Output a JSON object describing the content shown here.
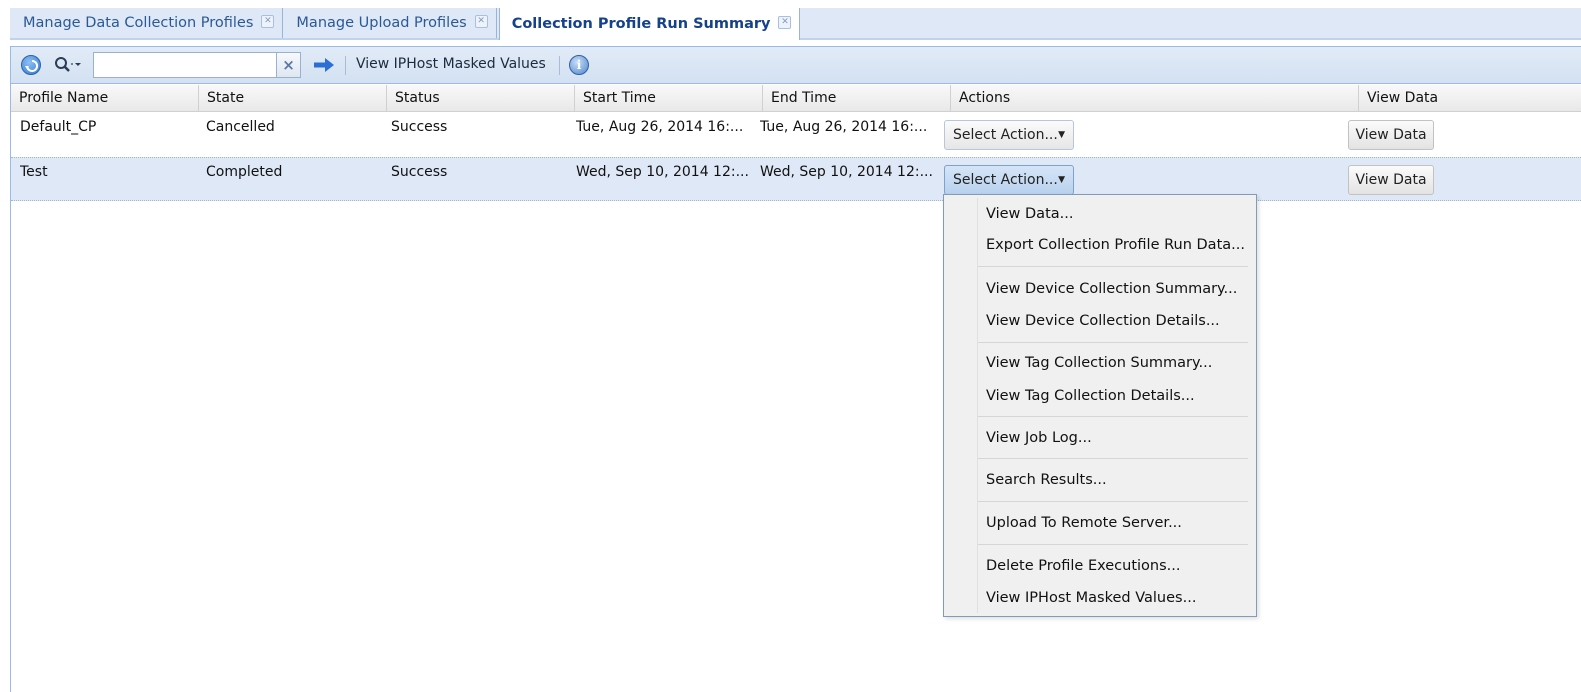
{
  "tabs": [
    {
      "label": "Manage Data Collection Profiles",
      "active": false
    },
    {
      "label": "Manage Upload Profiles",
      "active": false
    },
    {
      "label": "Collection Profile Run Summary",
      "active": true
    }
  ],
  "toolbar": {
    "search_value": "",
    "clear_label": "×",
    "masked_values_label": "View IPHost Masked Values",
    "info_label": "i"
  },
  "grid": {
    "columns": [
      "Profile Name",
      "State",
      "Status",
      "Start Time",
      "End Time",
      "Actions",
      "View Data"
    ],
    "rows": [
      {
        "profile_name": "Default_CP",
        "state": "Cancelled",
        "status": "Success",
        "start_time": "Tue, Aug 26, 2014 16:...",
        "end_time": "Tue, Aug 26, 2014 16:...",
        "action_label": "Select Action...",
        "view_data_label": "View Data"
      },
      {
        "profile_name": "Test",
        "state": "Completed",
        "status": "Success",
        "start_time": "Wed, Sep 10, 2014 12:...",
        "end_time": "Wed, Sep 10, 2014 12:...",
        "action_label": "Select Action...",
        "view_data_label": "View Data"
      }
    ]
  },
  "action_menu": {
    "items": [
      "View Data...",
      "Export Collection Profile Run Data...",
      "View Device Collection Summary...",
      "View Device Collection Details...",
      "View Tag Collection Summary...",
      "View Tag Collection Details...",
      "View Job Log...",
      "Search Results...",
      "Upload To Remote Server...",
      "Delete Profile Executions...",
      "View IPHost Masked Values..."
    ]
  }
}
